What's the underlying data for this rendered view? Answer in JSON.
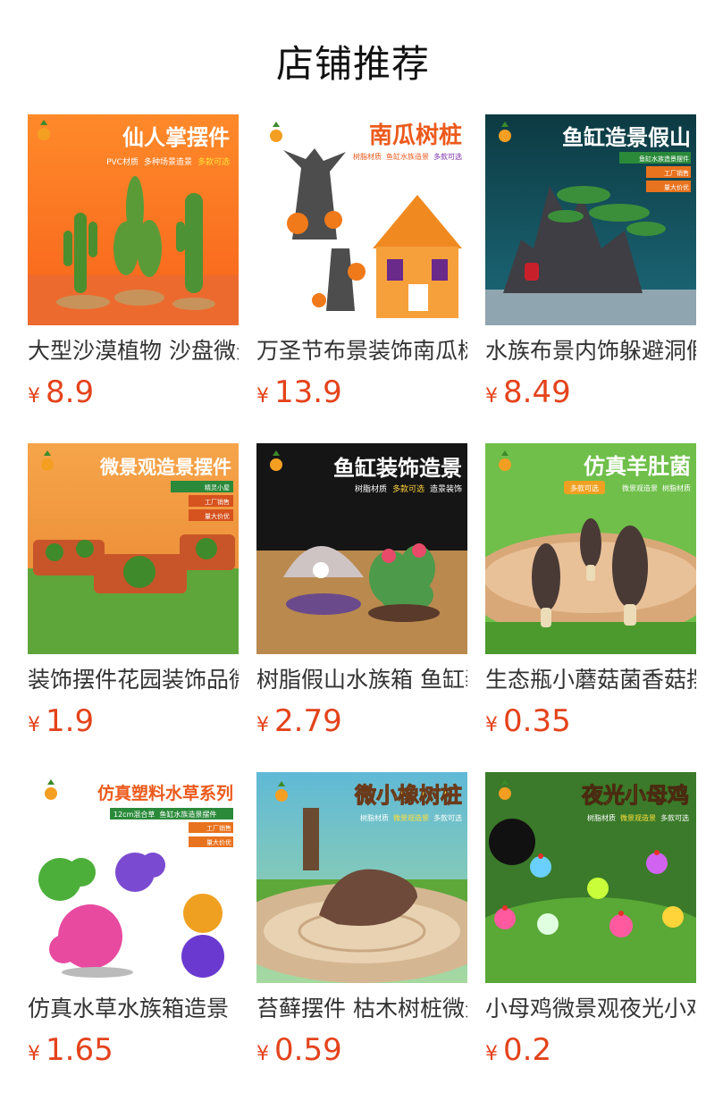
{
  "store_title": "店铺推荐",
  "products": [
    {
      "name": "大型沙漠植物 沙盘微景观",
      "currency": "¥",
      "price": "8.9",
      "banner": {
        "title": "仙人掌摆件",
        "sub": [
          "PVC材质",
          "多种场景造景",
          "多款可选"
        ]
      }
    },
    {
      "name": "万圣节布景装饰南瓜树桩",
      "currency": "¥",
      "price": "13.9",
      "banner": {
        "title": "南瓜树桩",
        "sub": [
          "树脂材质",
          "鱼缸水族造景",
          "多款可选"
        ]
      }
    },
    {
      "name": "水族布景内饰躲避洞假山",
      "currency": "¥",
      "price": "8.49",
      "banner": {
        "title": "鱼缸造景假山",
        "sub": [
          "鱼缸水族造景摆件",
          "工厂销售",
          "量大价优"
        ]
      }
    },
    {
      "name": "装饰摆件花园装饰品微景观",
      "currency": "¥",
      "price": "1.9",
      "banner": {
        "title": "微景观造景摆件",
        "sub": [
          "精灵小屋",
          "工厂销售",
          "量大价优"
        ]
      }
    },
    {
      "name": "树脂假山水族箱 鱼缸装饰",
      "currency": "¥",
      "price": "2.79",
      "banner": {
        "title": "鱼缸装饰造景",
        "sub": [
          "树脂材质",
          "多款可选",
          "造景装饰"
        ]
      }
    },
    {
      "name": "生态瓶小蘑菇菌香菇摆件",
      "currency": "¥",
      "price": "0.35",
      "banner": {
        "title": "仿真羊肚菌",
        "sub": [
          "多款可选",
          "微景观造景",
          "树脂材质"
        ]
      }
    },
    {
      "name": "仿真水草水族箱造景",
      "currency": "¥",
      "price": "1.65",
      "banner": {
        "title": "仿真塑料水草系列",
        "sub": [
          "12cm混合草",
          "鱼缸水族造景摆件",
          "工厂销售",
          "量大价优"
        ]
      }
    },
    {
      "name": "苔藓摆件 枯木树桩微景观",
      "currency": "¥",
      "price": "0.59",
      "banner": {
        "title": "微小橡树桩",
        "sub": [
          "树脂材质",
          "微景观造景",
          "多款可选"
        ]
      }
    },
    {
      "name": "小母鸡微景观夜光小鸡",
      "currency": "¥",
      "price": "0.2",
      "banner": {
        "title": "夜光小母鸡",
        "sub": [
          "树脂材质",
          "微景观造景",
          "多款可选"
        ]
      }
    }
  ]
}
